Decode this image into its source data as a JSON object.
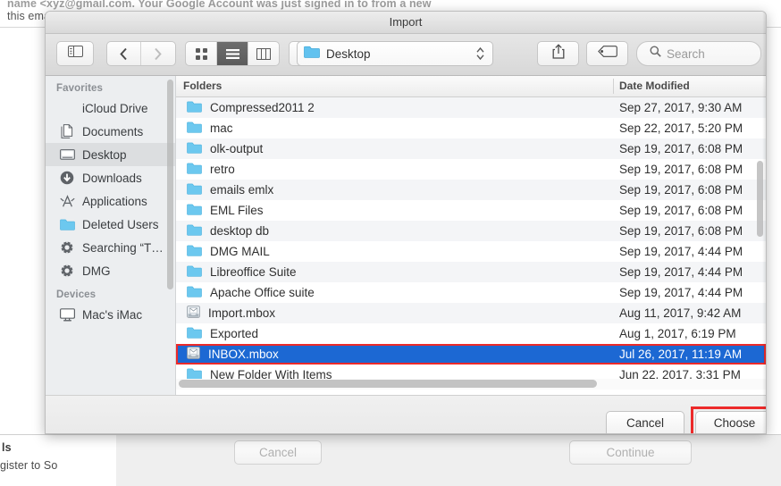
{
  "background": {
    "top_line_1": "name <xyz@gmail.com. Your Google Account was just signed in to from a new",
    "top_line_2": "this email to",
    "bottom_line_1": "ls",
    "bottom_line_2": "gister to So",
    "cancel_label": "Cancel",
    "continue_label": "Continue"
  },
  "dialog": {
    "title": "Import",
    "toolbar": {
      "sidebar_toggle": "sidebar-toggle-icon",
      "back_label": "‹",
      "forward_label": "›",
      "view_icon": "icon-view",
      "view_list": "list-view",
      "view_column": "column-view",
      "arrange_label": "arrange-menu",
      "path_folder": "Desktop",
      "share_icon": "share-icon",
      "tag_icon": "tag-icon",
      "search_placeholder": "Search"
    },
    "sidebar": {
      "groups": [
        {
          "title": "Favorites",
          "items": [
            {
              "label": "iCloud Drive",
              "icon": "icloud-icon",
              "selected": false
            },
            {
              "label": "Documents",
              "icon": "documents-icon",
              "selected": false
            },
            {
              "label": "Desktop",
              "icon": "desktop-icon",
              "selected": true
            },
            {
              "label": "Downloads",
              "icon": "downloads-icon",
              "selected": false
            },
            {
              "label": "Applications",
              "icon": "applications-icon",
              "selected": false
            },
            {
              "label": "Deleted Users",
              "icon": "folder-icon",
              "selected": false
            },
            {
              "label": "Searching “T…",
              "icon": "gear-icon",
              "selected": false
            },
            {
              "label": "DMG",
              "icon": "gear-icon",
              "selected": false
            }
          ]
        },
        {
          "title": "Devices",
          "items": [
            {
              "label": "Mac's iMac",
              "icon": "imac-icon",
              "selected": false
            }
          ]
        }
      ]
    },
    "filelist": {
      "columns": [
        "Folders",
        "Date Modified"
      ],
      "rows": [
        {
          "name": "Compressed2011 2",
          "date": "Sep 27, 2017, 9:30 AM",
          "icon": "folder-icon",
          "selected": false
        },
        {
          "name": "mac",
          "date": "Sep 22, 2017, 5:20 PM",
          "icon": "folder-icon",
          "selected": false
        },
        {
          "name": "olk-output",
          "date": "Sep 19, 2017, 6:08 PM",
          "icon": "folder-icon",
          "selected": false
        },
        {
          "name": "retro",
          "date": "Sep 19, 2017, 6:08 PM",
          "icon": "folder-icon",
          "selected": false
        },
        {
          "name": "emails emlx",
          "date": "Sep 19, 2017, 6:08 PM",
          "icon": "folder-icon",
          "selected": false
        },
        {
          "name": "EML Files",
          "date": "Sep 19, 2017, 6:08 PM",
          "icon": "folder-icon",
          "selected": false
        },
        {
          "name": "desktop db",
          "date": "Sep 19, 2017, 6:08 PM",
          "icon": "folder-icon",
          "selected": false
        },
        {
          "name": "DMG MAIL",
          "date": "Sep 19, 2017, 4:44 PM",
          "icon": "folder-icon",
          "selected": false
        },
        {
          "name": "Libreoffice Suite",
          "date": "Sep 19, 2017, 4:44 PM",
          "icon": "folder-icon",
          "selected": false
        },
        {
          "name": "Apache Office suite",
          "date": "Sep 19, 2017, 4:44 PM",
          "icon": "folder-icon",
          "selected": false
        },
        {
          "name": "Import.mbox",
          "date": "Aug 11, 2017, 9:42 AM",
          "icon": "mbox-icon",
          "selected": false
        },
        {
          "name": "Exported",
          "date": "Aug 1, 2017, 6:19 PM",
          "icon": "folder-icon",
          "selected": false
        },
        {
          "name": "INBOX.mbox",
          "date": "Jul 26, 2017, 11:19 AM",
          "icon": "mbox-icon",
          "selected": true
        },
        {
          "name": "New Folder With Items",
          "date": "Jun 22, 2017, 3:31 PM",
          "icon": "folder-icon",
          "selected": false
        }
      ]
    },
    "footer": {
      "cancel_label": "Cancel",
      "choose_label": "Choose"
    }
  },
  "annotations": {
    "highlight_color": "#ec2a2a",
    "selection_color": "#1c68d3"
  }
}
